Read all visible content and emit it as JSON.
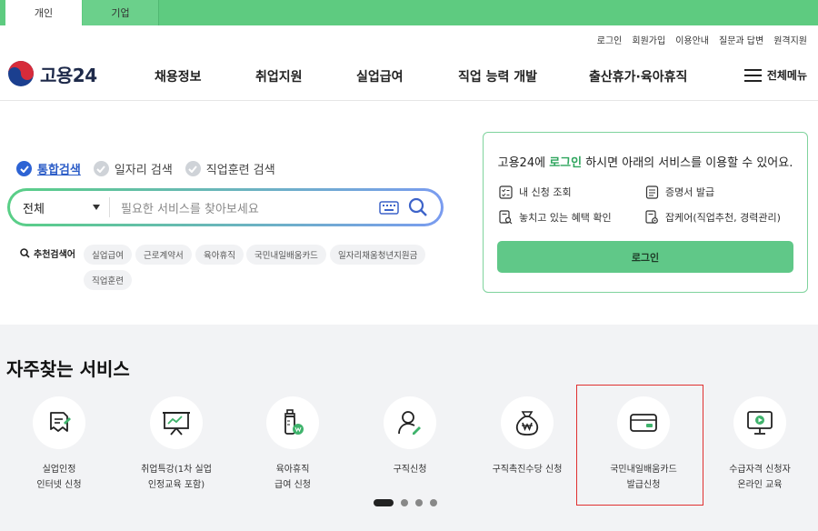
{
  "top_tabs": [
    "개인",
    "기업"
  ],
  "util_links": [
    "로그인",
    "회원가입",
    "이용안내",
    "질문과 답변",
    "원격지원"
  ],
  "logo": {
    "text": "고용24"
  },
  "nav": [
    "채용정보",
    "취업지원",
    "실업급여",
    "직업 능력 개발",
    "출산휴가·육아휴직"
  ],
  "all_menu": "전체메뉴",
  "search": {
    "tabs": [
      "통합검색",
      "일자리 검색",
      "직업훈련 검색"
    ],
    "scope": "전체",
    "placeholder": "필요한 서비스를 찾아보세요"
  },
  "recommended": {
    "title": "추천검색어",
    "tags": [
      "실업급여",
      "근로계약서",
      "육아휴직",
      "국민내일배움카드",
      "일자리채움청년지원금",
      "직업훈련"
    ]
  },
  "login_box": {
    "title_pre": "고용24에 ",
    "title_link": "로그인",
    "title_post": " 하시면 아래의 서비스를 이용할 수 있어요.",
    "items": [
      "내 신청 조회",
      "증명서 발급",
      "놓치고 있는 혜택 확인",
      "잡케어(직업추천, 경력관리)"
    ],
    "button": "로그인"
  },
  "frequent": {
    "title": "자주찾는 서비스",
    "services": [
      {
        "line1": "실업인정",
        "line2": "인터넷 신청",
        "icon": "certificate-icon"
      },
      {
        "line1": "취업특강(1차 실업",
        "line2": "인정교육 포함)",
        "icon": "lecture-board-icon"
      },
      {
        "line1": "육아휴직",
        "line2": "급여 신청",
        "icon": "baby-bottle-icon"
      },
      {
        "line1": "구직신청",
        "line2": "",
        "icon": "person-edit-icon"
      },
      {
        "line1": "구직촉진수당 신청",
        "line2": "",
        "icon": "money-bag-icon"
      },
      {
        "line1": "국민내일배움카드",
        "line2": "발급신청",
        "icon": "card-icon"
      },
      {
        "line1": "수급자격 신청자",
        "line2": "온라인 교육",
        "icon": "monitor-play-icon"
      }
    ]
  },
  "colors": {
    "brand_green": "#5ecb80",
    "accent_blue": "#2d63d4",
    "highlight_red": "#e03030"
  }
}
